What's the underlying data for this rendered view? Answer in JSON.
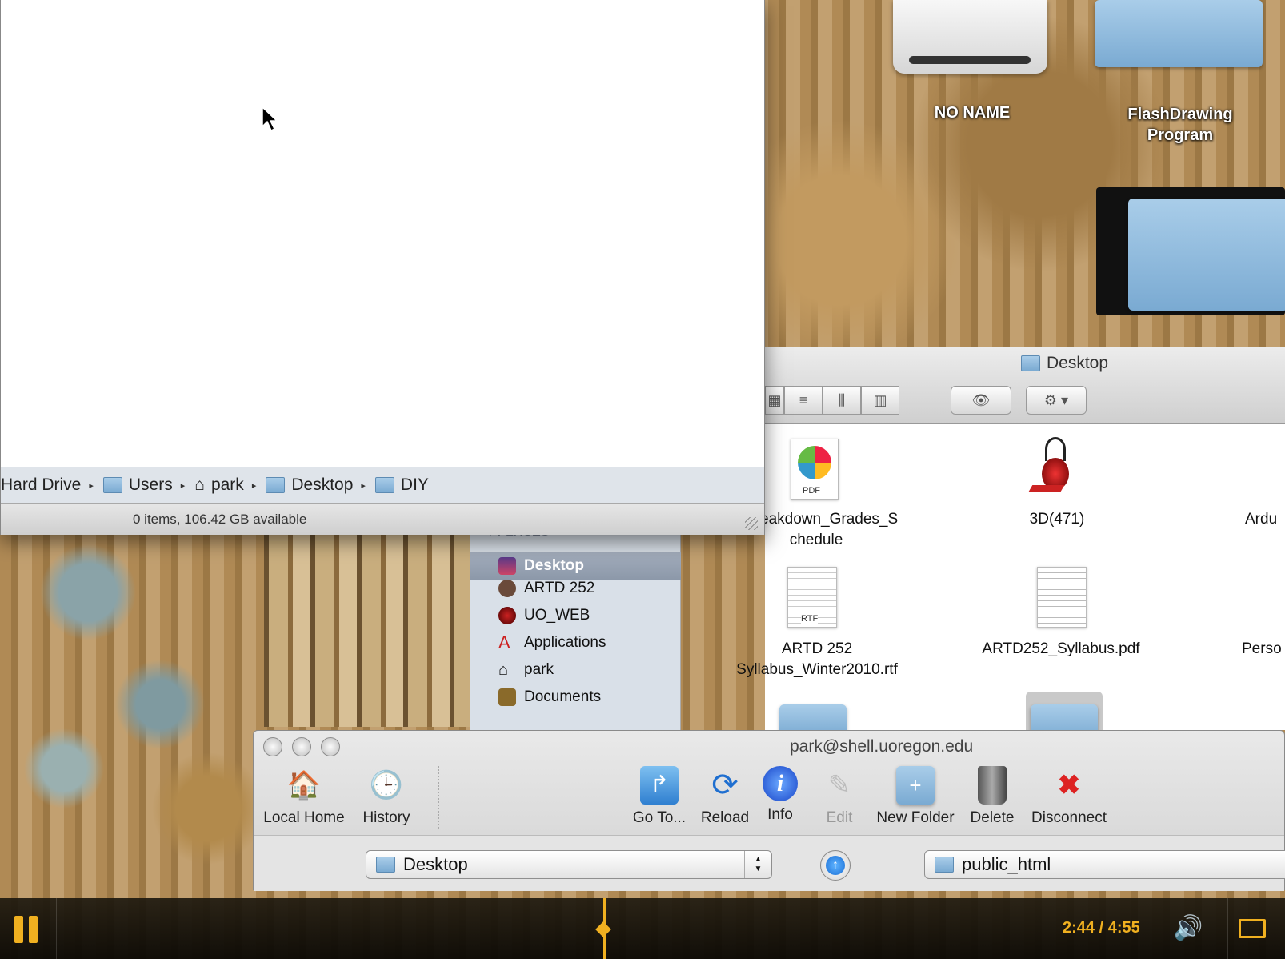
{
  "diy_window": {
    "path": [
      "Hard Drive",
      "Users",
      "park",
      "Desktop",
      "DIY"
    ],
    "status": "0 items, 106.42 GB available"
  },
  "desktop_icons": {
    "drive_label": "NO NAME",
    "folder1_label_line1": "FlashDrawing",
    "folder1_label_line2": "Program"
  },
  "desktop_window": {
    "title": "Desktop",
    "files": [
      {
        "line1": "eakdown_Grades_S",
        "line2": "chedule"
      },
      {
        "line1": "3D(471)",
        "line2": ""
      },
      {
        "line1": "Ardu",
        "line2": ""
      },
      {
        "line1": "ARTD 252",
        "line2": "Syllabus_Winter2010.rtf"
      },
      {
        "line1": "ARTD252_Syllabus.pdf",
        "line2": ""
      },
      {
        "line1": "Perso",
        "line2": ""
      }
    ],
    "sidebar_header": "PLACES",
    "sidebar": [
      "Desktop",
      "ARTD 252",
      "UO_WEB",
      "Applications",
      "park",
      "Documents"
    ]
  },
  "fetch_window": {
    "title": "park@shell.uoregon.edu",
    "toolbar": {
      "local_home": "Local Home",
      "history": "History",
      "goto": "Go To...",
      "reload": "Reload",
      "info": "Info",
      "edit": "Edit",
      "new_folder": "New Folder",
      "delete": "Delete",
      "disconnect": "Disconnect"
    },
    "local_popup": "Desktop",
    "remote_popup": "public_html"
  },
  "player": {
    "time": "2:44 / 4:55"
  },
  "colors": {
    "accent": "#f0b020",
    "sidebar_selection": "#8c98a9"
  }
}
